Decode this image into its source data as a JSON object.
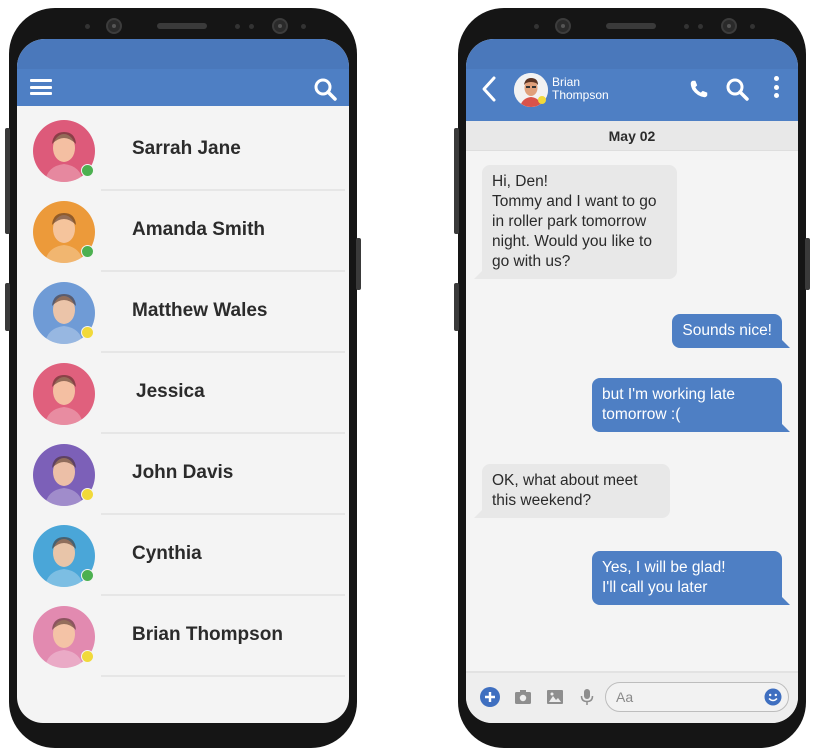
{
  "colors": {
    "accent": "#4e7fc4",
    "online": "#4cb050",
    "away": "#f1d93a"
  },
  "contacts_screen": {
    "appbar": {
      "menu_icon": "hamburger-menu-icon",
      "search_icon": "search-icon"
    },
    "contacts": [
      {
        "name": "Sarrah Jane",
        "status": "online",
        "avatar_bg": "#dd5a7a"
      },
      {
        "name": "Amanda Smith",
        "status": "online",
        "avatar_bg": "#ec9a3a"
      },
      {
        "name": "Matthew Wales",
        "status": "away",
        "avatar_bg": "#6f9bd6"
      },
      {
        "name": "Jessica",
        "status": "none",
        "avatar_bg": "#e0607d"
      },
      {
        "name": "John Davis",
        "status": "away",
        "avatar_bg": "#7c60b8"
      },
      {
        "name": "Cynthia",
        "status": "online",
        "avatar_bg": "#4aa6d8"
      },
      {
        "name": "Brian Thompson",
        "status": "away",
        "avatar_bg": "#e28ab0"
      }
    ]
  },
  "chat_screen": {
    "header": {
      "back_icon": "chevron-left-icon",
      "contact_first": "Brian",
      "contact_last": "Thompson",
      "contact_status": "away",
      "call_icon": "phone-icon",
      "search_icon": "search-icon",
      "more_icon": "kebab-menu-icon"
    },
    "date_label": "May 02",
    "messages": [
      {
        "direction": "in",
        "lines": [
          "Hi, Den!",
          "Tommy and I want to go",
          "in roller park tomorrow",
          "night. Would you like to",
          "go with us?"
        ]
      },
      {
        "direction": "out",
        "lines": [
          "Sounds nice!"
        ]
      },
      {
        "direction": "out",
        "lines": [
          "but I'm working late",
          "tomorrow :("
        ]
      },
      {
        "direction": "in",
        "lines": [
          "OK, what about meet",
          "this weekend?"
        ]
      },
      {
        "direction": "out",
        "lines": [
          "Yes, I will be glad!",
          "I'll call you later"
        ]
      }
    ],
    "composer": {
      "placeholder": "Aa",
      "icons": [
        "plus-icon",
        "camera-icon",
        "image-icon",
        "microphone-icon",
        "emoji-icon"
      ]
    }
  }
}
